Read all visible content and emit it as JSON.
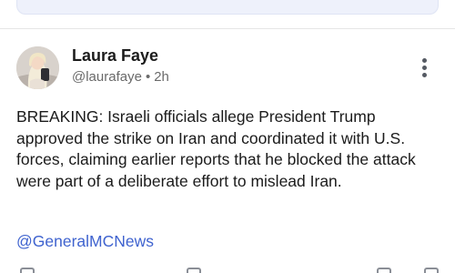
{
  "post": {
    "author_name": "Laura Faye",
    "handle": "@laurafaye",
    "separator": "•",
    "time": "2h",
    "body": "BREAKING: Israeli officials allege President Trump approved the strike on Iran and coordinated it with U.S. forces, claiming earlier reports that he blocked the attack were part of a deliberate effort to mislead Iran.",
    "mention": "@GeneralMCNews"
  },
  "icons": {
    "menu": "more-vertical-icon",
    "reply": "reply-icon",
    "share": "share-icon",
    "bookmark": "bookmark-icon"
  },
  "colors": {
    "link": "#3f63cf",
    "top_strip": "#eef1fb",
    "meta_text": "#6a6a6a"
  }
}
